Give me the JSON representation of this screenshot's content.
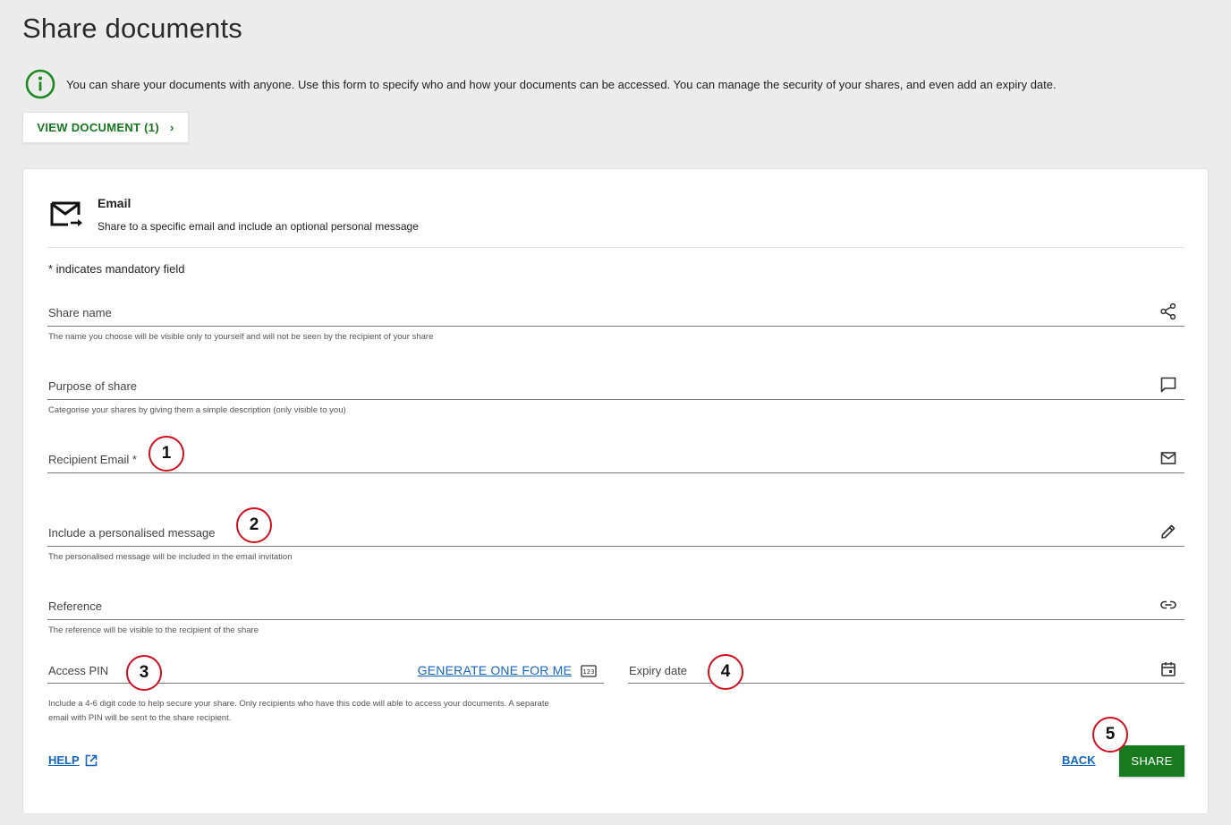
{
  "page": {
    "title": "Share documents",
    "info_text": "You can share your documents with anyone. Use this form to specify who and how your documents can be accessed. You can manage the security of your shares, and even add an expiry date.",
    "view_document_label": "VIEW DOCUMENT (1)",
    "view_document_chevron": "›"
  },
  "card": {
    "email_title": "Email",
    "email_desc": "Share to a specific email and include an optional personal message",
    "mandatory_note": "* indicates mandatory field"
  },
  "fields": {
    "share_name": {
      "label": "Share name",
      "hint": "The name you choose will be visible only to yourself and will not be seen by the recipient of your share",
      "icon": "share-icon"
    },
    "purpose": {
      "label": "Purpose of share",
      "hint": "Categorise your shares by giving them a simple description (only visible to you)",
      "icon": "comment-icon"
    },
    "recipient_email": {
      "label": "Recipient Email *",
      "icon": "mail-icon"
    },
    "message": {
      "label": "Include a personalised message",
      "hint": "The personalised message will be included in the email invitation",
      "icon": "pencil-icon"
    },
    "reference": {
      "label": "Reference",
      "hint": "The reference will be visible to the recipient of the share",
      "icon": "link-icon"
    },
    "access_pin": {
      "label": "Access PIN",
      "generate_label": "GENERATE ONE FOR ME",
      "hint_line1": "Include a 4-6 digit code to help secure your share. Only recipients who have this code will able to access your documents. A separate",
      "hint_line2": "email with PIN will be sent to the share recipient.",
      "icon": "keypad-123-icon"
    },
    "expiry_date": {
      "label": "Expiry date",
      "icon": "calendar-icon"
    }
  },
  "actions": {
    "help_label": "HELP",
    "back_label": "BACK",
    "share_label": "SHARE"
  },
  "markers": [
    "1",
    "2",
    "3",
    "4",
    "5"
  ],
  "colors": {
    "accent_green": "#177a1f",
    "link_blue": "#1565c0",
    "marker_red": "#d01020",
    "background": "#ececec"
  }
}
